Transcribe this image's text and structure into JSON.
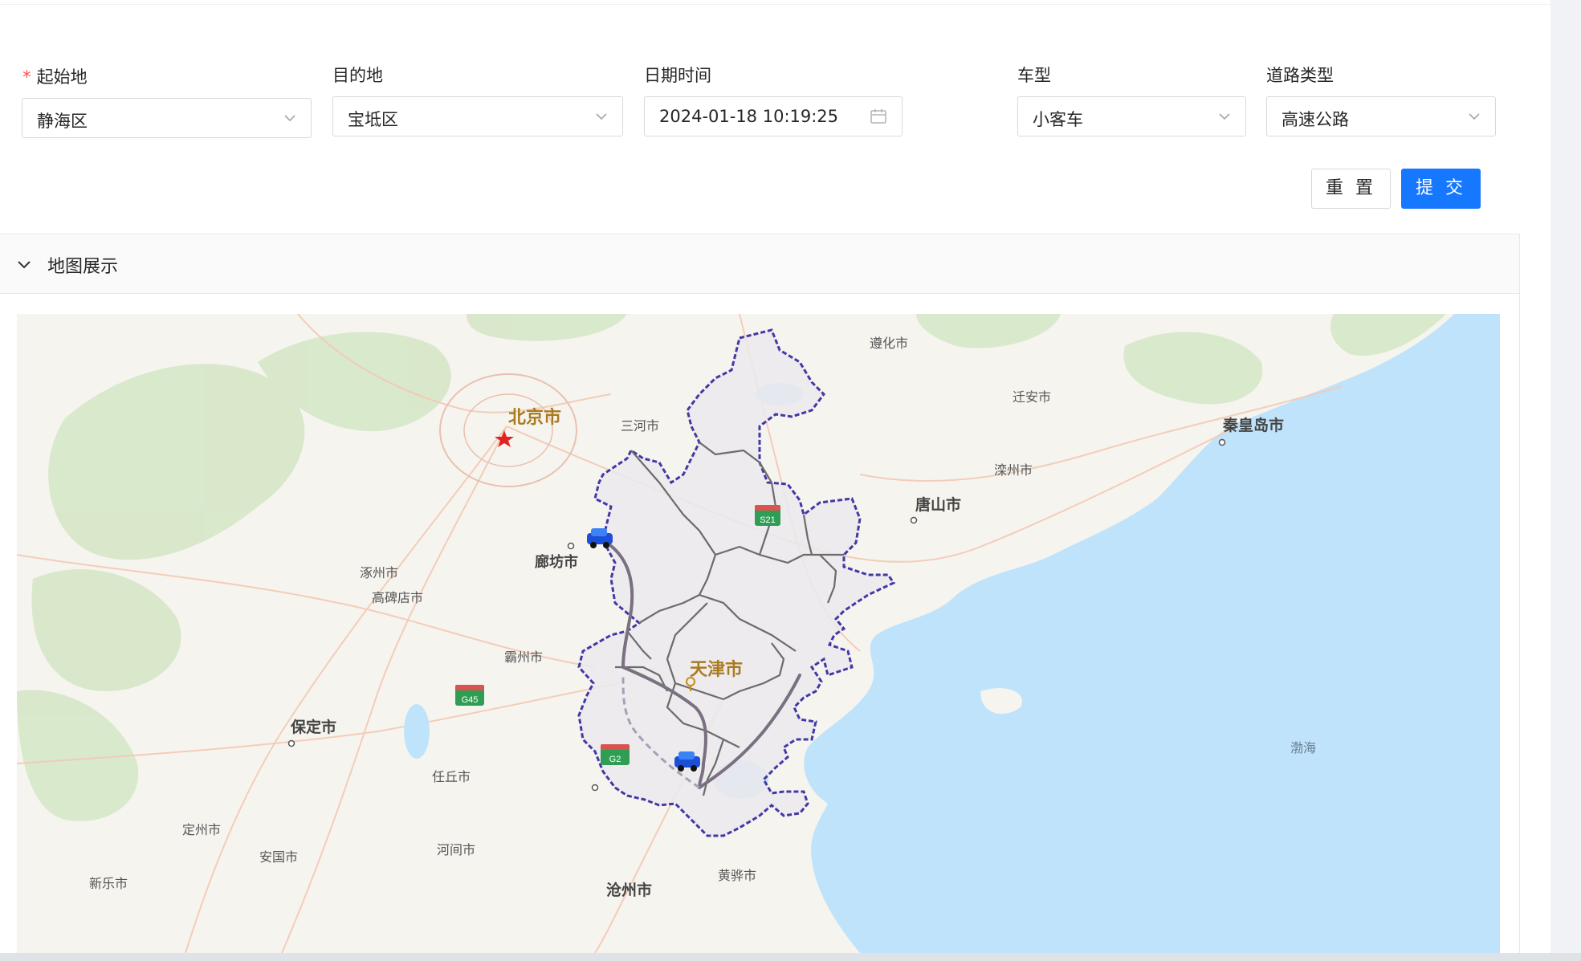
{
  "form": {
    "origin": {
      "label": "起始地",
      "required_mark": "*",
      "value": "静海区"
    },
    "destination": {
      "label": "目的地",
      "value": "宝坻区"
    },
    "datetime": {
      "label": "日期时间",
      "value": "2024-01-18 10:19:25"
    },
    "vehicle_type": {
      "label": "车型",
      "value": "小客车"
    },
    "road_type": {
      "label": "道路类型",
      "value": "高速公路"
    }
  },
  "buttons": {
    "reset": "重 置",
    "submit": "提 交"
  },
  "panel": {
    "title": "地图展示"
  },
  "map": {
    "labels": {
      "beijing": "北京市",
      "tianjin": "天津市",
      "langfang": "廊坊市",
      "sanhe": "三河市",
      "zunhua": "遵化市",
      "qianan": "迁安市",
      "qinhuangdao": "秦皇岛市",
      "luanzhou": "滦州市",
      "tangshan": "唐山市",
      "zhuozhou": "涿州市",
      "gaobeidian": "高碑店市",
      "bazhou": "霸州市",
      "baoding": "保定市",
      "renqiu": "任丘市",
      "dingzhou": "定州市",
      "anguo": "安国市",
      "hejian": "河间市",
      "xinle": "新乐市",
      "cangzhou": "沧州市",
      "huanghua": "黄骅市",
      "bohai": "渤海"
    },
    "highway_shields": {
      "s21": "S21",
      "g45": "G45",
      "g2": "G2"
    },
    "colors": {
      "sea": "#bfe3fb",
      "land": "#f6f4ef",
      "region_fill": "#ebe9ec",
      "boundary": "#4338a6",
      "route": "#7a7080"
    }
  }
}
